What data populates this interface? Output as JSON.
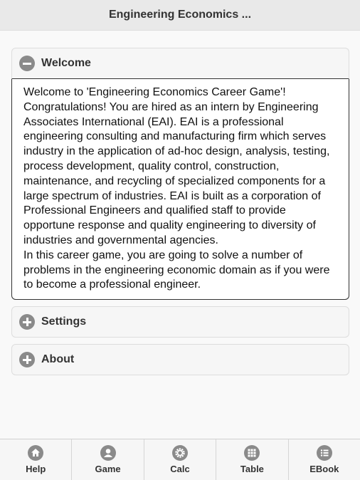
{
  "header": {
    "title": "Engineering Economics ..."
  },
  "sections": [
    {
      "label": "Welcome",
      "expanded": true,
      "icon": "minus-icon",
      "paragraphs": [
        "Welcome to 'Engineering Economics Career Game'! Congratulations! You are hired as an intern by Engineering Associates International (EAI). EAI is a professional engineering consulting and manufacturing firm which serves industry in the application of ad-hoc design, analysis, testing, process development, quality control, construction, maintenance, and recycling of specialized components for a large spectrum of industries. EAI is built as a corporation of Professional Engineers and qualified staff to provide opportune response and quality engineering to diversity of industries and governmental agencies.",
        "In this career game, you are going to solve a number of problems in the engineering economic domain as if you were to become a professional engineer."
      ]
    },
    {
      "label": "Settings",
      "expanded": false,
      "icon": "plus-icon"
    },
    {
      "label": "About",
      "expanded": false,
      "icon": "plus-icon"
    }
  ],
  "navbar": {
    "items": [
      {
        "label": "Help",
        "icon": "home-icon"
      },
      {
        "label": "Game",
        "icon": "user-icon"
      },
      {
        "label": "Calc",
        "icon": "gear-icon"
      },
      {
        "label": "Table",
        "icon": "grid-icon"
      },
      {
        "label": "EBook",
        "icon": "list-icon"
      }
    ]
  },
  "colors": {
    "header_bg": "#e9e9e9",
    "icon_gray": "#8a8a8a",
    "panel_bg": "#f6f6f6"
  }
}
